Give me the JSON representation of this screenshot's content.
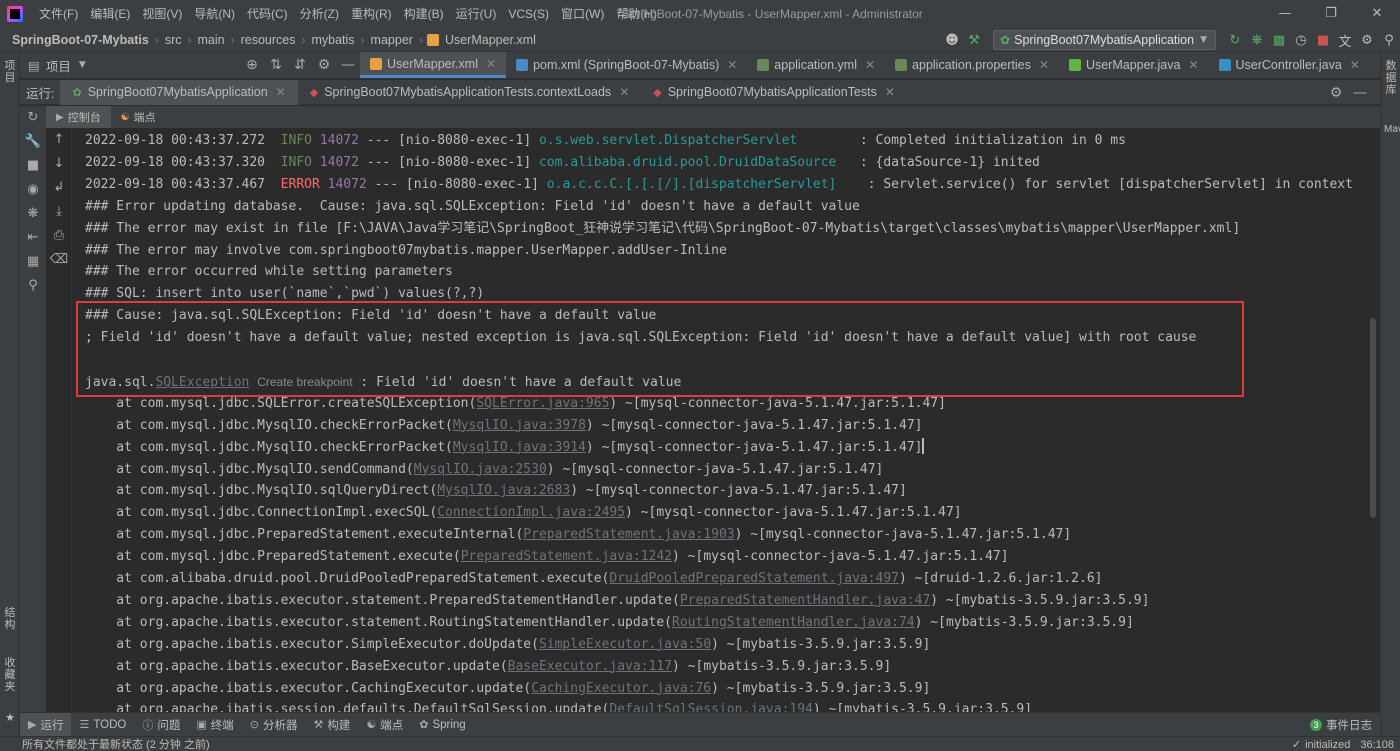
{
  "titlebar": {
    "menu": [
      "文件(F)",
      "编辑(E)",
      "视图(V)",
      "导航(N)",
      "代码(C)",
      "分析(Z)",
      "重构(R)",
      "构建(B)",
      "运行(U)",
      "VCS(S)",
      "窗口(W)",
      "帮助(H)"
    ],
    "window_title": "SpringBoot-07-Mybatis - UserMapper.xml - Administrator"
  },
  "breadcrumb": [
    "SpringBoot-07-Mybatis",
    "src",
    "main",
    "resources",
    "mybatis",
    "mapper",
    "UserMapper.xml"
  ],
  "run_config": "SpringBoot07MybatisApplication",
  "tool_windows": {
    "left_top": "项目",
    "left_bottom_1": "结构",
    "left_bottom_2": "收藏夹",
    "right_1": "数据库",
    "right_2": "Maven"
  },
  "project_tab": "项目",
  "editor_tabs": [
    {
      "label": "UserMapper.xml",
      "icon": "xml-file-icon",
      "color": "#e8a040",
      "active": true
    },
    {
      "label": "pom.xml (SpringBoot-07-Mybatis)",
      "icon": "maven-file-icon",
      "color": "#4a88c7",
      "active": false
    },
    {
      "label": "application.yml",
      "icon": "spring-config-icon",
      "color": "#6a8759",
      "active": false
    },
    {
      "label": "application.properties",
      "icon": "spring-config-icon",
      "color": "#6a8759",
      "active": false
    },
    {
      "label": "UserMapper.java",
      "icon": "interface-icon",
      "color": "#62b543",
      "active": false
    },
    {
      "label": "UserController.java",
      "icon": "class-icon",
      "color": "#3592c4",
      "active": false
    }
  ],
  "run": {
    "label": "运行:",
    "tabs": [
      {
        "label": "SpringBoot07MybatisApplication",
        "active": true
      },
      {
        "label": "SpringBoot07MybatisApplicationTests.contextLoads",
        "active": false
      },
      {
        "label": "SpringBoot07MybatisApplicationTests",
        "active": false
      }
    ],
    "subtabs": [
      "控制台",
      "端点"
    ]
  },
  "console": {
    "log": [
      {
        "ts": "2022-09-18 00:43:37.272",
        "level": "INFO",
        "pid": "14072",
        "thread": " --- [nio-8080-exec-1] ",
        "logger": "o.s.web.servlet.DispatcherServlet       ",
        "msg": " : Completed initialization in 0 ms"
      },
      {
        "ts": "2022-09-18 00:43:37.320",
        "level": "INFO",
        "pid": "14072",
        "thread": " --- [nio-8080-exec-1] ",
        "logger": "com.alibaba.druid.pool.DruidDataSource  ",
        "msg": " : {dataSource-1} inited"
      },
      {
        "ts": "2022-09-18 00:43:37.467",
        "level": "ERROR",
        "pid": "14072",
        "thread": " --- [nio-8080-exec-1] ",
        "logger": "o.a.c.c.C.[.[.[/].[dispatcherServlet]   ",
        "msg": " : Servlet.service() for servlet [dispatcherServlet] in context"
      }
    ],
    "plain": [
      "### Error updating database.  Cause: java.sql.SQLException: Field 'id' doesn't have a default value",
      "### The error may exist in file [F:\\JAVA\\Java学习笔记\\SpringBoot_狂神说学习笔记\\代码\\SpringBoot-07-Mybatis\\target\\classes\\mybatis\\mapper\\UserMapper.xml]",
      "### The error may involve com.springboot07mybatis.mapper.UserMapper.addUser-Inline",
      "### The error occurred while setting parameters",
      "### SQL: insert into user(`name`,`pwd`) values(?,?)",
      "### Cause: java.sql.SQLException: Field 'id' doesn't have a default value",
      "; Field 'id' doesn't have a default value; nested exception is java.sql.SQLException: Field 'id' doesn't have a default value] with root cause",
      ""
    ],
    "exception": {
      "prefix": "java.sql.",
      "link": "SQLException",
      "hint": "Create breakpoint",
      "msg": " : Field 'id' doesn't have a default value"
    },
    "stack": [
      {
        "pre": "    at com.mysql.jdbc.SQLError.createSQLException(",
        "link": "SQLError.java:965",
        "post": ") ~[mysql-connector-java-5.1.47.jar:5.1.47]"
      },
      {
        "pre": "    at com.mysql.jdbc.MysqlIO.checkErrorPacket(",
        "link": "MysqlIO.java:3978",
        "post": ") ~[mysql-connector-java-5.1.47.jar:5.1.47]"
      },
      {
        "pre": "    at com.mysql.jdbc.MysqlIO.checkErrorPacket(",
        "link": "MysqlIO.java:3914",
        "post": ") ~[mysql-connector-java-5.1.47.jar:5.1.47]"
      },
      {
        "pre": "    at com.mysql.jdbc.MysqlIO.sendCommand(",
        "link": "MysqlIO.java:2530",
        "post": ") ~[mysql-connector-java-5.1.47.jar:5.1.47]"
      },
      {
        "pre": "    at com.mysql.jdbc.MysqlIO.sqlQueryDirect(",
        "link": "MysqlIO.java:2683",
        "post": ") ~[mysql-connector-java-5.1.47.jar:5.1.47]"
      },
      {
        "pre": "    at com.mysql.jdbc.ConnectionImpl.execSQL(",
        "link": "ConnectionImpl.java:2495",
        "post": ") ~[mysql-connector-java-5.1.47.jar:5.1.47]"
      },
      {
        "pre": "    at com.mysql.jdbc.PreparedStatement.executeInternal(",
        "link": "PreparedStatement.java:1903",
        "post": ") ~[mysql-connector-java-5.1.47.jar:5.1.47]"
      },
      {
        "pre": "    at com.mysql.jdbc.PreparedStatement.execute(",
        "link": "PreparedStatement.java:1242",
        "post": ") ~[mysql-connector-java-5.1.47.jar:5.1.47]"
      },
      {
        "pre": "    at com.alibaba.druid.pool.DruidPooledPreparedStatement.execute(",
        "link": "DruidPooledPreparedStatement.java:497",
        "post": ") ~[druid-1.2.6.jar:1.2.6]"
      },
      {
        "pre": "    at org.apache.ibatis.executor.statement.PreparedStatementHandler.update(",
        "link": "PreparedStatementHandler.java:47",
        "post": ") ~[mybatis-3.5.9.jar:3.5.9]"
      },
      {
        "pre": "    at org.apache.ibatis.executor.statement.RoutingStatementHandler.update(",
        "link": "RoutingStatementHandler.java:74",
        "post": ") ~[mybatis-3.5.9.jar:3.5.9]"
      },
      {
        "pre": "    at org.apache.ibatis.executor.SimpleExecutor.doUpdate(",
        "link": "SimpleExecutor.java:50",
        "post": ") ~[mybatis-3.5.9.jar:3.5.9]"
      },
      {
        "pre": "    at org.apache.ibatis.executor.BaseExecutor.update(",
        "link": "BaseExecutor.java:117",
        "post": ") ~[mybatis-3.5.9.jar:3.5.9]"
      },
      {
        "pre": "    at org.apache.ibatis.executor.CachingExecutor.update(",
        "link": "CachingExecutor.java:76",
        "post": ") ~[mybatis-3.5.9.jar:3.5.9]"
      },
      {
        "pre": "    at org.apache.ibatis.session.defaults.DefaultSqlSession.update(",
        "link": "DefaultSqlSession.java:194",
        "post": ") ~[mybatis-3.5.9.jar:3.5.9]"
      }
    ]
  },
  "bottom_tabs": [
    {
      "label": "运行",
      "icon": "run-icon",
      "active": true
    },
    {
      "label": "TODO",
      "icon": "todo-icon",
      "active": false
    },
    {
      "label": "问题",
      "icon": "problems-icon",
      "active": false
    },
    {
      "label": "终端",
      "icon": "terminal-icon",
      "active": false
    },
    {
      "label": "分析器",
      "icon": "profiler-icon",
      "active": false
    },
    {
      "label": "构建",
      "icon": "build-icon",
      "active": false
    },
    {
      "label": "端点",
      "icon": "endpoints-icon",
      "active": false
    },
    {
      "label": "Spring",
      "icon": "spring-icon",
      "active": false
    }
  ],
  "event_log": {
    "count": "3",
    "label": "事件日志"
  },
  "status": {
    "message": "所有文件都处于最新状态 (2 分钟 之前)",
    "right_status": "initialized",
    "position": "36:108"
  },
  "colors": {
    "info": "#6a8759",
    "error": "#ff6b68",
    "pid": "#9876aa",
    "logger": "#299999",
    "highlight_box": "#e03c3c",
    "active_tab_underline": "#4a88c7"
  }
}
